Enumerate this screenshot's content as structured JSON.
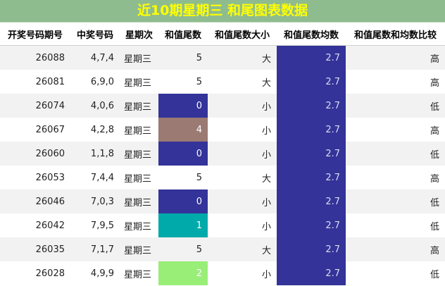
{
  "title": "近10期星期三 和尾图表数据",
  "columns": [
    "开奖号码期号",
    "中奖号码",
    "星期次",
    "和值尾数",
    "和值尾数大小",
    "和值尾数均数",
    "和值尾数和均数比较"
  ],
  "colors": {
    "title_bg": "#8fbc8f",
    "title_text": "#ffff00",
    "avg_bg": "#333399",
    "tail_0": "#333399",
    "tail_1": "#00aaaa",
    "tail_2": "#99ee77",
    "tail_4": "#9a7a72"
  },
  "rows": [
    {
      "issue": "26088",
      "numbers": "4,7,4",
      "weekday": "星期三",
      "tail": "5",
      "size": "大",
      "avg": "2.7",
      "compare": "高",
      "tail_color": ""
    },
    {
      "issue": "26081",
      "numbers": "6,9,0",
      "weekday": "星期三",
      "tail": "5",
      "size": "大",
      "avg": "2.7",
      "compare": "高",
      "tail_color": ""
    },
    {
      "issue": "26074",
      "numbers": "4,0,6",
      "weekday": "星期三",
      "tail": "0",
      "size": "小",
      "avg": "2.7",
      "compare": "低",
      "tail_color": "#333399"
    },
    {
      "issue": "26067",
      "numbers": "4,2,8",
      "weekday": "星期三",
      "tail": "4",
      "size": "小",
      "avg": "2.7",
      "compare": "高",
      "tail_color": "#9a7a72"
    },
    {
      "issue": "26060",
      "numbers": "1,1,8",
      "weekday": "星期三",
      "tail": "0",
      "size": "小",
      "avg": "2.7",
      "compare": "低",
      "tail_color": "#333399"
    },
    {
      "issue": "26053",
      "numbers": "7,4,4",
      "weekday": "星期三",
      "tail": "5",
      "size": "大",
      "avg": "2.7",
      "compare": "高",
      "tail_color": ""
    },
    {
      "issue": "26046",
      "numbers": "7,0,3",
      "weekday": "星期三",
      "tail": "0",
      "size": "小",
      "avg": "2.7",
      "compare": "低",
      "tail_color": "#333399"
    },
    {
      "issue": "26042",
      "numbers": "7,9,5",
      "weekday": "星期三",
      "tail": "1",
      "size": "小",
      "avg": "2.7",
      "compare": "低",
      "tail_color": "#00aaaa"
    },
    {
      "issue": "26035",
      "numbers": "7,1,7",
      "weekday": "星期三",
      "tail": "5",
      "size": "大",
      "avg": "2.7",
      "compare": "高",
      "tail_color": ""
    },
    {
      "issue": "26028",
      "numbers": "4,9,9",
      "weekday": "星期三",
      "tail": "2",
      "size": "小",
      "avg": "2.7",
      "compare": "低",
      "tail_color": "#99ee77"
    }
  ]
}
